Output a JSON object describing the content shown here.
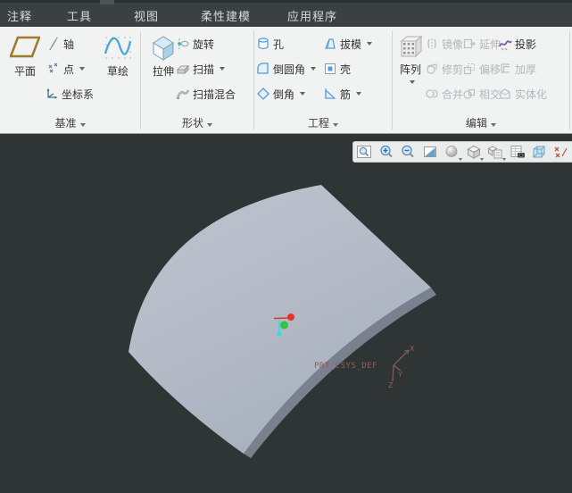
{
  "menu": {
    "tabs": [
      "注释",
      "工具",
      "视图",
      "柔性建模",
      "应用程序"
    ]
  },
  "ribbon": {
    "datum": {
      "label": "基准",
      "plane": "平面",
      "axis": "轴",
      "point": "点",
      "csys": "坐标系",
      "sketch": "草绘"
    },
    "shapes": {
      "label": "形状",
      "extrude": "拉伸",
      "revolve": "旋转",
      "sweep": "扫描",
      "swept_blend": "扫描混合"
    },
    "engineering": {
      "label": "工程",
      "hole": "孔",
      "round": "倒圆角",
      "chamfer": "倒角",
      "draft": "拔模",
      "shell": "壳",
      "rib": "筋"
    },
    "editing": {
      "label": "编辑",
      "pattern": "阵列",
      "mirror": "镜像",
      "trim": "修剪",
      "merge": "合并",
      "extend": "延伸",
      "offset": "偏移",
      "intersect": "相交",
      "project": "投影",
      "thicken": "加厚",
      "solidify": "实体化"
    }
  },
  "viewport_toolbar": {
    "icons": [
      "zoom-window-icon",
      "zoom-in-icon",
      "zoom-out-icon",
      "refit-icon",
      "shading-style-icon",
      "display-style-icon",
      "saved-orientations-icon",
      "view-manager-icon",
      "perspective-icon",
      "datum-display-filters-icon"
    ]
  },
  "viewport": {
    "csys_name": "PRT_CSYS_DEF",
    "axes": {
      "x": "X",
      "y": "Y",
      "z": "Z"
    }
  },
  "colors": {
    "menubar_bg": "#3b4141",
    "ribbon_bg": "#f1f2f2",
    "viewport_bg": "#2f3434",
    "surface": "#b4bbc7",
    "surface_edge": "#78818d",
    "csys_label": "#8d5e5e",
    "marker_red": "#e63226",
    "marker_green": "#35c143",
    "marker_cyan": "#27e0e0",
    "accent_gold": "#9a7d2e",
    "accent_blue": "#45a8d8",
    "project_purple": "#7e5fa0"
  }
}
